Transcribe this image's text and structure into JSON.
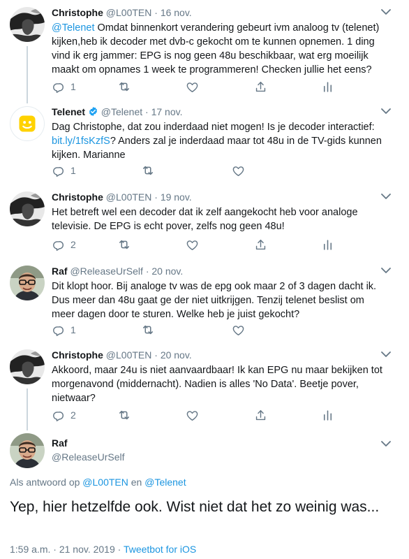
{
  "colors": {
    "accent": "#1b95e0",
    "muted": "#657786",
    "line": "#ccd6dd",
    "telenet_yellow": "#ffd200"
  },
  "tweets": [
    {
      "name": "Christophe",
      "handle": "@L00TEN",
      "date": "16 nov.",
      "mention": "@Telenet",
      "text": " Omdat binnenkort verandering gebeurt ivm analoog tv (telenet) kijken,heb ik decoder met dvb-c gekocht om te kunnen opnemen. 1 ding vind ik erg jammer: EPG is nog geen 48u beschikbaar, wat erg moeilijk maakt om opnames 1 week te programmeren! Checken jullie het eens?",
      "reply_count": "1"
    },
    {
      "name": "Telenet",
      "handle": "@Telenet",
      "date": "17 nov.",
      "text_before": "Dag Christophe, dat zou inderdaad niet mogen! Is je decoder interactief: ",
      "link": "bit.ly/1fsKzfS",
      "text_after": "? Anders zal je inderdaad maar tot 48u in de TV-gids kunnen kijken. Marianne",
      "reply_count": "1"
    },
    {
      "name": "Christophe",
      "handle": "@L00TEN",
      "date": "19 nov.",
      "text": "Het betreft wel een decoder dat ik zelf aangekocht heb voor analoge televisie. De EPG is echt pover, zelfs nog geen 48u!",
      "reply_count": "2"
    },
    {
      "name": "Raf",
      "handle": "@ReleaseUrSelf",
      "date": "20 nov.",
      "text": "Dit klopt hoor. Bij analoge tv was de epg ook maar 2 of 3 dagen dacht ik. Dus meer dan 48u gaat ge der niet uitkrijgen. Tenzij telenet beslist om meer dagen door te sturen. Welke heb je juist gekocht?",
      "reply_count": "1"
    },
    {
      "name": "Christophe",
      "handle": "@L00TEN",
      "date": "20 nov.",
      "text": "Akkoord, maar 24u is niet aanvaardbaar! Ik kan EPG nu maar bekijken tot morgenavond (middernacht). Nadien is alles 'No Data'. Beetje pover, nietwaar?",
      "reply_count": "2"
    }
  ],
  "main": {
    "name": "Raf",
    "handle": "@ReleaseUrSelf",
    "reply_to_label": "Als antwoord op",
    "reply_to_1": "@L00TEN",
    "reply_to_and": "en",
    "reply_to_2": "@Telenet",
    "text": "Yep, hier hetzelfde ook. Wist niet dat het zo weinig was...",
    "time": "1:59 a.m.",
    "sep": "·",
    "date": "21 nov. 2019",
    "sep2": "·",
    "source": "Tweetbot for iOS"
  },
  "header_sep": "·"
}
